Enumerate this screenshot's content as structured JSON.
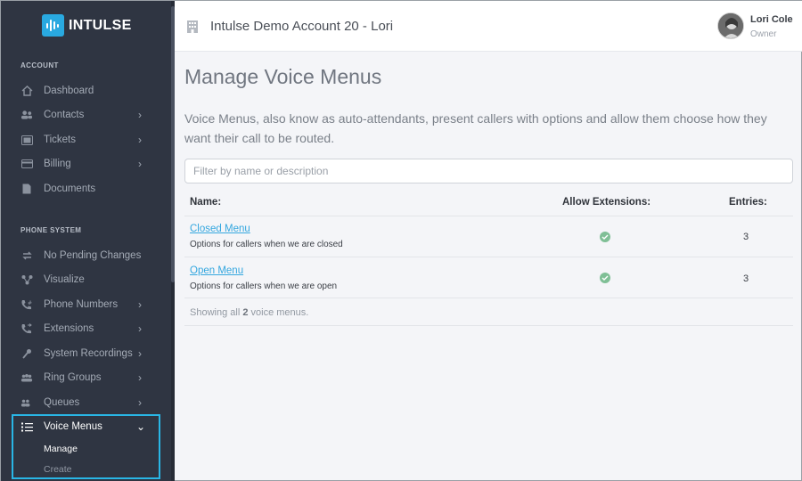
{
  "brand": {
    "name": "INTULSE",
    "accent": "#29a9e0"
  },
  "sidebar": {
    "sections": [
      {
        "label": "ACCOUNT",
        "items": [
          {
            "label": "Dashboard",
            "icon": "home-icon",
            "chevron": false
          },
          {
            "label": "Contacts",
            "icon": "contacts-icon",
            "chevron": true
          },
          {
            "label": "Tickets",
            "icon": "ticket-icon",
            "chevron": true
          },
          {
            "label": "Billing",
            "icon": "credit-card-icon",
            "chevron": true
          },
          {
            "label": "Documents",
            "icon": "document-icon",
            "chevron": false
          }
        ]
      },
      {
        "label": "PHONE SYSTEM",
        "items": [
          {
            "label": "No Pending Changes",
            "icon": "sync-icon",
            "chevron": false
          },
          {
            "label": "Visualize",
            "icon": "network-icon",
            "chevron": false
          },
          {
            "label": "Phone Numbers",
            "icon": "phone-hash-icon",
            "chevron": true
          },
          {
            "label": "Extensions",
            "icon": "phone-forward-icon",
            "chevron": true
          },
          {
            "label": "System Recordings",
            "icon": "microphone-icon",
            "chevron": true
          },
          {
            "label": "Ring Groups",
            "icon": "group-icon",
            "chevron": true
          },
          {
            "label": "Queues",
            "icon": "queue-icon",
            "chevron": true
          },
          {
            "label": "Voice Menus",
            "icon": "list-icon",
            "chevron": true,
            "expanded": true,
            "children": [
              {
                "label": "Manage",
                "active": true
              },
              {
                "label": "Create",
                "active": false
              }
            ]
          }
        ]
      }
    ]
  },
  "header": {
    "account_name": "Intulse Demo Account 20 - Lori",
    "user": {
      "name": "Lori Cole",
      "role": "Owner"
    }
  },
  "main": {
    "title": "Manage Voice Menus",
    "description": "Voice Menus, also know as auto-attendants, present callers with options and allow them choose how they want their call to be routed.",
    "filter_placeholder": "Filter by name or description",
    "columns": [
      "Name:",
      "Allow Extensions:",
      "Entries:"
    ],
    "rows": [
      {
        "name": "Closed Menu",
        "description": "Options for callers when we are closed",
        "allow_extensions": true,
        "entries": "3"
      },
      {
        "name": "Open Menu",
        "description": "Options for callers when we are open",
        "allow_extensions": true,
        "entries": "3"
      }
    ],
    "summary": {
      "prefix": "Showing all",
      "count": "2",
      "suffix": "voice menus."
    }
  }
}
